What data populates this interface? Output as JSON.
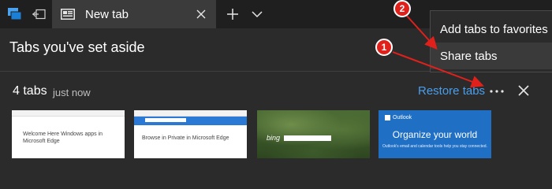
{
  "tab": {
    "title": "New tab"
  },
  "panel": {
    "title": "Tabs you've set aside"
  },
  "tab_set": {
    "count_label": "4 tabs",
    "time_label": "just now",
    "restore_label": "Restore tabs"
  },
  "thumbnails": [
    {
      "caption": "Welcome Here Windows apps in Microsoft Edge"
    },
    {
      "caption": "Browse in Private in Microsoft Edge"
    },
    {
      "caption": "bing"
    },
    {
      "brand": "Outlook",
      "headline": "Organize your world",
      "subtext": "Outlook's email and calendar tools help you stay connected."
    }
  ],
  "context_menu": {
    "items": [
      "Add tabs to favorites",
      "Share tabs"
    ]
  },
  "annotations": {
    "callout1": "1",
    "callout2": "2"
  },
  "colors": {
    "accent_link": "#4a9eea",
    "callout": "#e0211b",
    "outlook_blue": "#1f6fc5"
  }
}
